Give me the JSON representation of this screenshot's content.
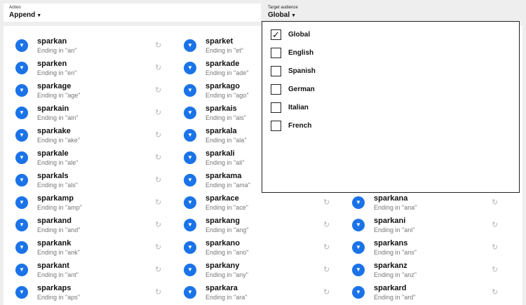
{
  "action": {
    "label": "Action",
    "value": "Append",
    "caret": "▼"
  },
  "audience": {
    "label": "Target audience",
    "value": "Global",
    "caret": "▼",
    "options": [
      {
        "label": "Global",
        "checked": true,
        "check_glyph": "✓"
      },
      {
        "label": "English",
        "checked": false,
        "check_glyph": ""
      },
      {
        "label": "Spanish",
        "checked": false,
        "check_glyph": ""
      },
      {
        "label": "German",
        "checked": false,
        "check_glyph": ""
      },
      {
        "label": "Italian",
        "checked": false,
        "check_glyph": ""
      },
      {
        "label": "French",
        "checked": false,
        "check_glyph": ""
      }
    ]
  },
  "icons": {
    "item_button": "▼",
    "refresh": "↻"
  },
  "colors": {
    "accent": "#1a73e8",
    "muted_text": "#777777",
    "refresh": "#b5b5b5"
  },
  "columns": [
    [
      {
        "word": "sparkan",
        "ending": "Ending in \"an\""
      },
      {
        "word": "sparken",
        "ending": "Ending in \"en\""
      },
      {
        "word": "sparkage",
        "ending": "Ending in \"age\""
      },
      {
        "word": "sparkain",
        "ending": "Ending in \"ain\""
      },
      {
        "word": "sparkake",
        "ending": "Ending in \"ake\""
      },
      {
        "word": "sparkale",
        "ending": "Ending in \"ale\""
      },
      {
        "word": "sparkals",
        "ending": "Ending in \"als\""
      },
      {
        "word": "sparkamp",
        "ending": "Ending in \"amp\""
      },
      {
        "word": "sparkand",
        "ending": "Ending in \"and\""
      },
      {
        "word": "sparkank",
        "ending": "Ending in \"ank\""
      },
      {
        "word": "sparkant",
        "ending": "Ending in \"ant\""
      },
      {
        "word": "sparkaps",
        "ending": "Ending in \"aps\""
      }
    ],
    [
      {
        "word": "sparket",
        "ending": "Ending in \"et\""
      },
      {
        "word": "sparkade",
        "ending": "Ending in \"ade\""
      },
      {
        "word": "sparkago",
        "ending": "Ending in \"ago\""
      },
      {
        "word": "sparkais",
        "ending": "Ending in \"ais\""
      },
      {
        "word": "sparkala",
        "ending": "Ending in \"ala\""
      },
      {
        "word": "sparkali",
        "ending": "Ending in \"ali\""
      },
      {
        "word": "sparkama",
        "ending": "Ending in \"ama\""
      },
      {
        "word": "sparkace",
        "ending": "Ending in \"ace\""
      },
      {
        "word": "sparkang",
        "ending": "Ending in \"ang\""
      },
      {
        "word": "sparkano",
        "ending": "Ending in \"ano\""
      },
      {
        "word": "sparkany",
        "ending": "Ending in \"any\""
      },
      {
        "word": "sparkara",
        "ending": "Ending in \"ara\""
      }
    ],
    [
      {
        "word": "sparkana",
        "ending": "Ending in \"ana\""
      },
      {
        "word": "sparkani",
        "ending": "Ending in \"ani\""
      },
      {
        "word": "sparkans",
        "ending": "Ending in \"ans\""
      },
      {
        "word": "sparkanz",
        "ending": "Ending in \"anz\""
      },
      {
        "word": "sparkard",
        "ending": "Ending in \"ard\""
      }
    ]
  ]
}
